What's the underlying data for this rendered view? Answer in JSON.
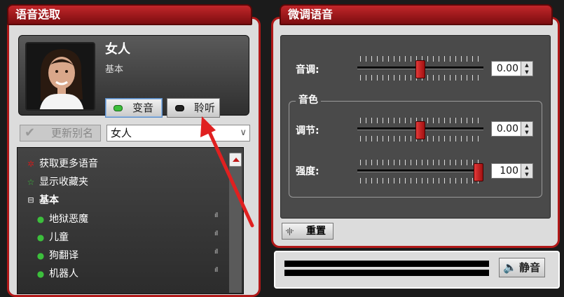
{
  "left_panel": {
    "title": "语音选取",
    "profile": {
      "name": "女人",
      "category": "基本"
    },
    "morph_button": "变音",
    "listen_button": "聆听",
    "update_alias_button": "更新别名",
    "alias_select": {
      "value": "女人"
    },
    "list": {
      "get_more": "获取更多语音",
      "show_favorites": "显示收藏夹",
      "group_basic": "基本",
      "voices": [
        "地狱恶魔",
        "儿童",
        "狗翻译",
        "机器人"
      ]
    }
  },
  "right_panel": {
    "title": "微调语音",
    "pitch": {
      "label": "音调:",
      "value": "0.00",
      "level": 0.5
    },
    "timbre_group": {
      "label": "音色",
      "adjust": {
        "label": "调节:",
        "value": "0.00",
        "level": 0.5
      },
      "strength": {
        "label": "强度:",
        "value": "100",
        "level": 1.0
      }
    },
    "reset_button": "重置"
  },
  "bottom": {
    "mute_button": "静音"
  },
  "colors": {
    "accent_red": "#b01818",
    "led_green": "#3cbf3c",
    "led_off": "#222222"
  }
}
